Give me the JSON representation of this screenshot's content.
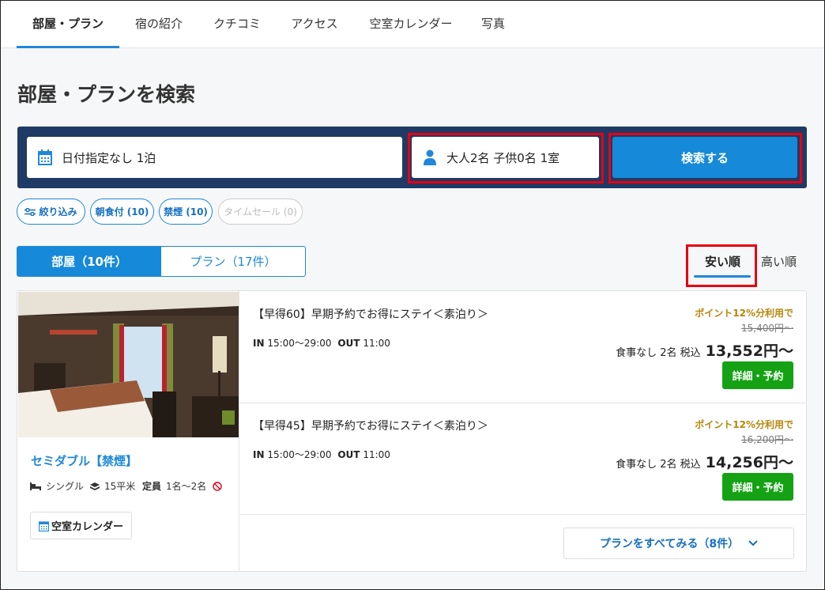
{
  "nav": {
    "tabs": [
      {
        "label": "部屋・プラン"
      },
      {
        "label": "宿の紹介"
      },
      {
        "label": "クチコミ"
      },
      {
        "label": "アクセス"
      },
      {
        "label": "空室カレンダー"
      },
      {
        "label": "写真"
      }
    ]
  },
  "page": {
    "title": "部屋・プランを検索"
  },
  "search": {
    "date_value": "日付指定なし 1泊",
    "guests_value": "大人2名 子供0名 1室",
    "search_label": "検索する"
  },
  "filters": [
    {
      "label": "絞り込み"
    },
    {
      "label": "朝食付 (10)"
    },
    {
      "label": "禁煙 (10)"
    },
    {
      "label": "タイムセール (0)"
    }
  ],
  "segment": {
    "rooms": "部屋（10件）",
    "plans": "プラン（17件）"
  },
  "sort": {
    "cheap": "安い順",
    "expensive": "高い順"
  },
  "room": {
    "name": "セミダブル【禁煙】",
    "bed": "シングル",
    "size": "15平米",
    "capacity_label": "定員",
    "capacity": "1名〜2名",
    "calendar_label": "空室カレンダー"
  },
  "plans": [
    {
      "title": "【早得60】早期予約でお得にステイ＜素泊り＞",
      "in_label": "IN",
      "in_time": "15:00〜29:00",
      "out_label": "OUT",
      "out_time": "11:00",
      "points": "ポイント12%分利用で",
      "original_price": "15,400円〜",
      "meal": "食事なし 2名 税込",
      "price": "13,552円〜",
      "cta": "詳細・予約"
    },
    {
      "title": "【早得45】早期予約でお得にステイ＜素泊り＞",
      "in_label": "IN",
      "in_time": "15:00〜29:00",
      "out_label": "OUT",
      "out_time": "11:00",
      "points": "ポイント12%分利用で",
      "original_price": "16,200円〜",
      "meal": "食事なし 2名 税込",
      "price": "14,256円〜",
      "cta": "詳細・予約"
    }
  ],
  "show_all": {
    "label": "プランをすべてみる（8件）"
  },
  "colors": {
    "accent": "#168ad8",
    "navy": "#1f3a64",
    "cta": "#14a214",
    "highlight": "#e60012"
  }
}
